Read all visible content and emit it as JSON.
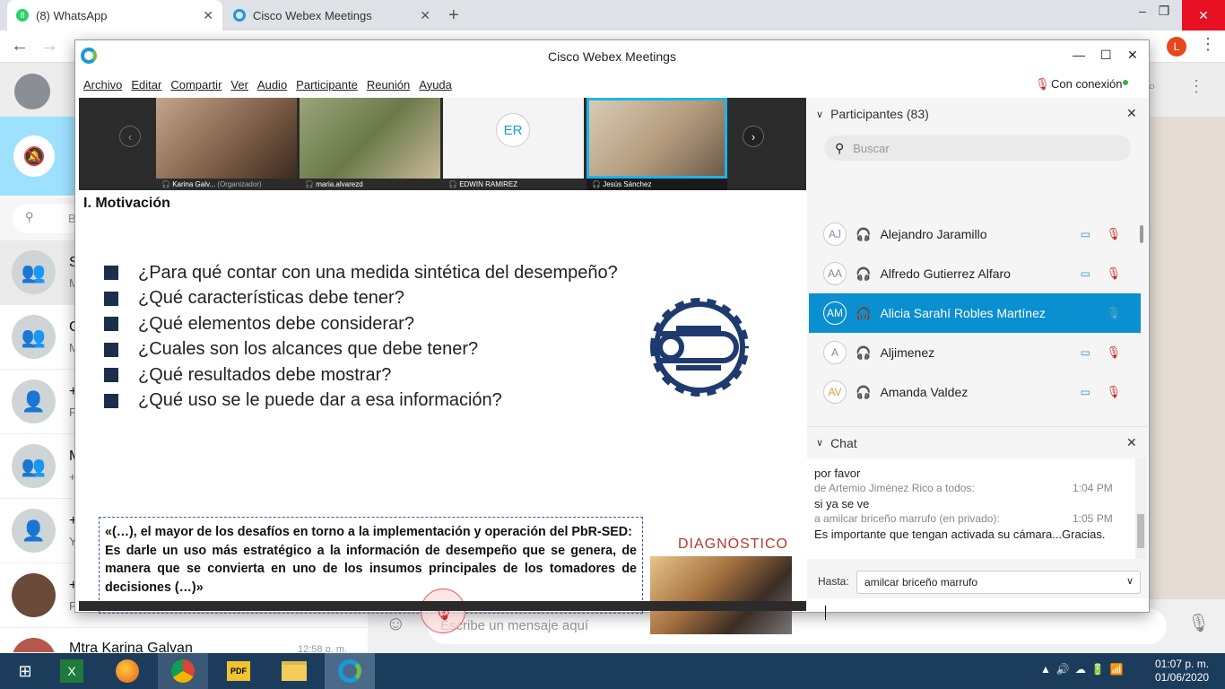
{
  "browser": {
    "tabs": [
      {
        "label": "(8) WhatsApp",
        "badge": "8"
      },
      {
        "label": "Cisco Webex Meetings"
      }
    ],
    "profile_initial": "L"
  },
  "whatsapp": {
    "search_placeholder": "B",
    "chats": [
      {
        "title": "S",
        "sub": "M"
      },
      {
        "title": "C",
        "sub": "M"
      },
      {
        "title": "+",
        "sub": "F"
      },
      {
        "title": "M",
        "sub": "+"
      },
      {
        "title": "+",
        "sub": "Y"
      },
      {
        "title": "+",
        "sub": "F"
      },
      {
        "title": "Mtra Karina Galvan",
        "time": "12:58 p. m."
      }
    ],
    "compose_placeholder": "Escribe un mensaje aquí"
  },
  "webex": {
    "title": "Cisco Webex Meetings",
    "menu": [
      "Archivo",
      "Editar",
      "Compartir",
      "Ver",
      "Audio",
      "Participante",
      "Reunión",
      "Ayuda"
    ],
    "connection": "Con conexión",
    "videos": [
      {
        "name": "Karina Galv...",
        "role": "(Organizador)"
      },
      {
        "name": "maria.alvarezd"
      },
      {
        "name": "EDWIN RAMIREZ",
        "initials": "ER"
      },
      {
        "name": "Jesús Sánchez"
      }
    ],
    "slide": {
      "heading": "I. Motivación",
      "bullets": [
        "¿Para qué contar con una medida sintética del desempeño?",
        "¿Qué características debe tener?",
        "¿Qué elementos debe considerar?",
        "¿Cuales son los alcances que debe tener?",
        "¿Qué resultados debe mostrar?",
        "¿Qué uso se le puede dar a esa información?"
      ],
      "quote_line1": "«(…), el mayor de los desafíos en torno a la implementación y operación del PbR-SED:",
      "quote_line2": "Es darle un uso más estratégico a la información de desempeño que se genera, de manera que se convierta en uno de los insumos principales de los tomadores de decisiones (…)»",
      "logo_text": "DIAGNÓSTICO"
    },
    "participants": {
      "header": "Participantes (83)",
      "search_placeholder": "Buscar",
      "list": [
        {
          "initials": "AJ",
          "name": "Alejandro Jaramillo"
        },
        {
          "initials": "AA",
          "name": "Alfredo Gutierrez Alfaro"
        },
        {
          "initials": "AM",
          "name": "Alicia Sarahí Robles Martínez",
          "selected": true
        },
        {
          "initials": "A",
          "name": "Aljimenez"
        },
        {
          "initials": "AV",
          "name": "Amanda Valdez"
        }
      ]
    },
    "chat": {
      "header": "Chat",
      "messages": [
        {
          "text": "por favor"
        },
        {
          "meta": "de Artemio Jiménez Rico a todos:",
          "time": "1:04 PM"
        },
        {
          "text": "si ya se ve"
        },
        {
          "meta": "a amilcar briceño marrufo (en privado):",
          "time": "1:05 PM"
        },
        {
          "text": "Es importante que tengan activada su cámara...Gracias."
        }
      ],
      "to_label": "Hasta:",
      "to_value": "amilcar briceño marrufo"
    }
  },
  "taskbar": {
    "time": "01:07 p. m.",
    "date": "01/06/2020"
  }
}
